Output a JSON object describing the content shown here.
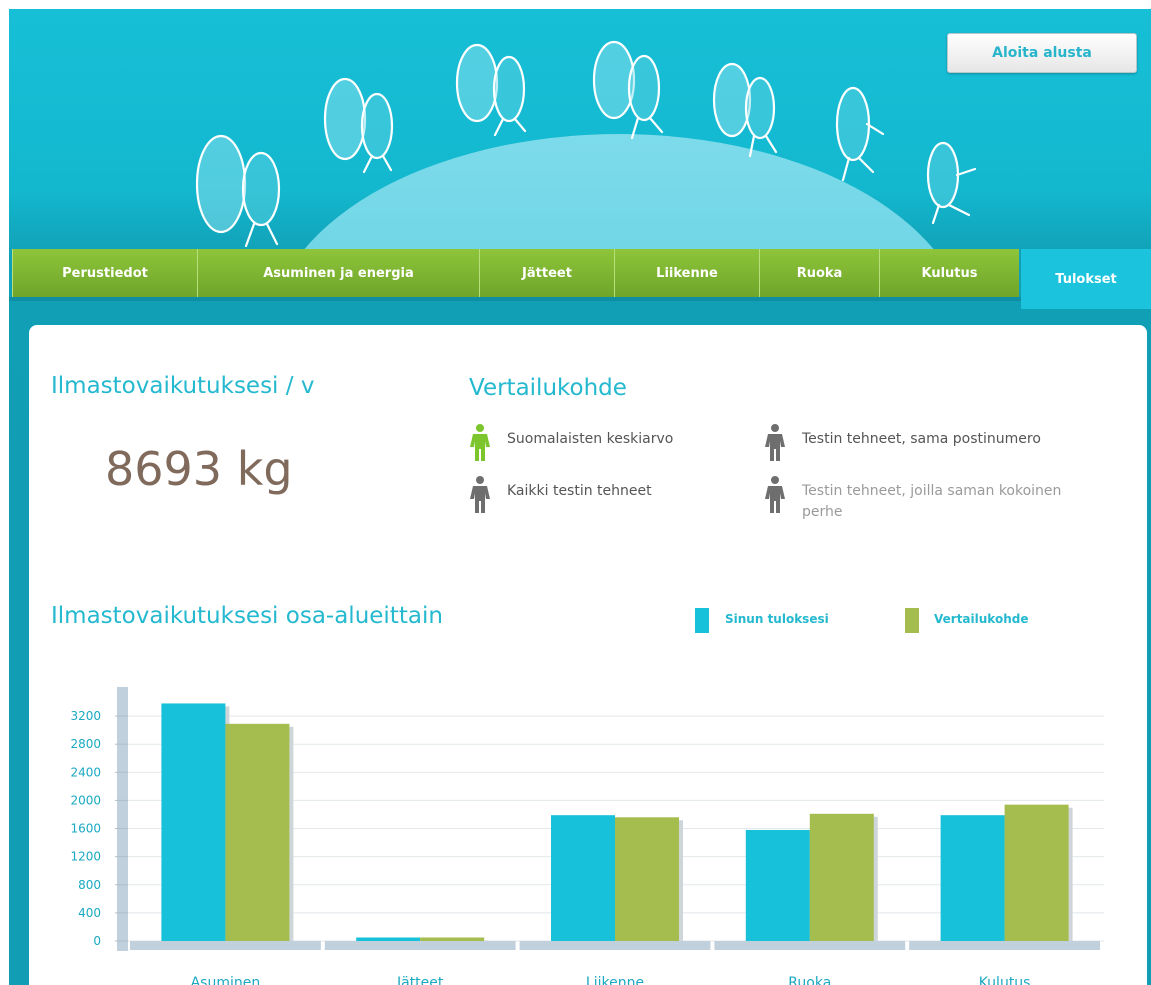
{
  "header": {
    "restart_label": "Aloita alusta"
  },
  "tabs": [
    {
      "label": "Perustiedot",
      "active": false
    },
    {
      "label": "Asuminen ja energia",
      "active": false
    },
    {
      "label": "Jätteet",
      "active": false
    },
    {
      "label": "Liikenne",
      "active": false
    },
    {
      "label": "Ruoka",
      "active": false
    },
    {
      "label": "Kulutus",
      "active": false
    },
    {
      "label": "Tulokset",
      "active": true
    }
  ],
  "summary": {
    "title": "Ilmastovaikutuksesi / v",
    "value": "8693 kg"
  },
  "comparison": {
    "title": "Vertailukohde",
    "options": [
      {
        "label": "Suomalaisten keskiarvo",
        "selected": true
      },
      {
        "label": "Testin tehneet, sama postinumero",
        "selected": false
      },
      {
        "label": "Kaikki testin tehneet",
        "selected": false
      },
      {
        "label": "Testin tehneet, joilla saman kokoinen perhe",
        "selected": false
      }
    ]
  },
  "chart_section": {
    "title": "Ilmastovaikutuksesi osa-alueittain",
    "legend": [
      {
        "label": "Sinun tuloksesi",
        "color": "#17c1da"
      },
      {
        "label": "Vertailukohde",
        "color": "#a5bd4f"
      }
    ]
  },
  "colors": {
    "teal": "#17c1da",
    "green_tab": "#7fb832",
    "olive": "#a5bd4f",
    "value_brown": "#7f6a5c"
  },
  "icons": {
    "header_art": "walking-backpack-characters-on-globe",
    "comparison_marker": "person-icon"
  },
  "chart_data": {
    "type": "bar",
    "categories": [
      "Asuminen",
      "Jätteet",
      "Liikenne",
      "Ruoka",
      "Kulutus"
    ],
    "series": [
      {
        "name": "Sinun tuloksesi",
        "values": [
          3380,
          50,
          1790,
          1580,
          1790
        ]
      },
      {
        "name": "Vertailukohde",
        "values": [
          3090,
          50,
          1760,
          1810,
          1940
        ]
      }
    ],
    "yticks": [
      0,
      400,
      800,
      1200,
      1600,
      2000,
      2400,
      2800,
      3200
    ],
    "ylim": [
      0,
      3500
    ],
    "grid": true,
    "legend_position": "top-right"
  }
}
